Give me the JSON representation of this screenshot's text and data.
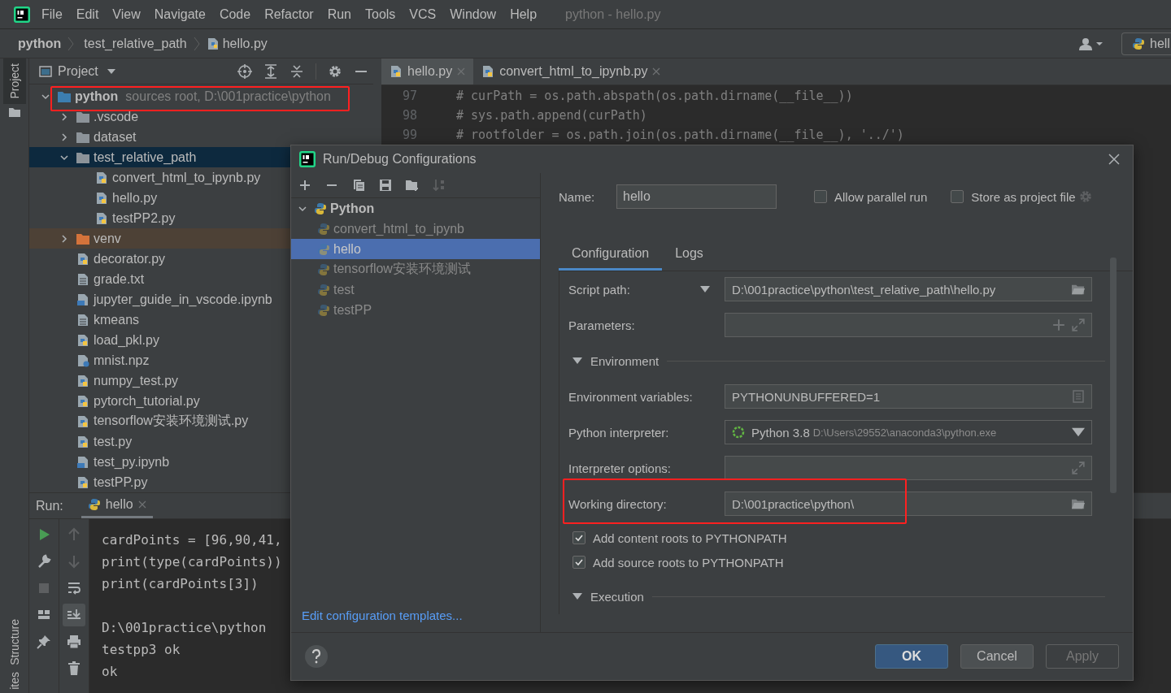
{
  "menu_bar": {
    "items": [
      "File",
      "Edit",
      "View",
      "Navigate",
      "Code",
      "Refactor",
      "Run",
      "Tools",
      "VCS",
      "Window",
      "Help"
    ],
    "title": "python - hello.py"
  },
  "breadcrumbs": [
    "python",
    "test_relative_path",
    "hello.py"
  ],
  "run_config": "hell",
  "side_tabs": {
    "top": [
      {
        "label": "Project",
        "selected": true
      }
    ],
    "bottom": [
      {
        "label": "Structure",
        "selected": false
      },
      {
        "label": "ites",
        "selected": false
      }
    ]
  },
  "project_panel": {
    "title": "Project",
    "tree": [
      {
        "name": "python",
        "kind": "root",
        "note": "sources root,  D:\\001practice\\python",
        "expanded": true,
        "selected": false,
        "children": [
          {
            "name": ".vscode",
            "kind": "folder",
            "expanded": false,
            "selected": false
          },
          {
            "name": "dataset",
            "kind": "folder",
            "expanded": false,
            "selected": false
          },
          {
            "name": "test_relative_path",
            "kind": "folder",
            "expanded": true,
            "selected": true,
            "children": [
              {
                "name": "convert_html_to_ipynb.py",
                "kind": "python",
                "selected": false
              },
              {
                "name": "hello.py",
                "kind": "python",
                "selected": false
              },
              {
                "name": "testPP2.py",
                "kind": "python",
                "selected": false
              }
            ]
          },
          {
            "name": "venv",
            "kind": "excluded",
            "expanded": false,
            "selected": false
          },
          {
            "name": "decorator.py",
            "kind": "python",
            "selected": false
          },
          {
            "name": "grade.txt",
            "kind": "text",
            "selected": false
          },
          {
            "name": "jupyter_guide_in_vscode.ipynb",
            "kind": "notebook",
            "selected": false
          },
          {
            "name": "kmeans",
            "kind": "text",
            "selected": false
          },
          {
            "name": "load_pkl.py",
            "kind": "python",
            "selected": false
          },
          {
            "name": "mnist.npz",
            "kind": "unknown",
            "selected": false
          },
          {
            "name": "numpy_test.py",
            "kind": "python",
            "selected": false
          },
          {
            "name": "pytorch_tutorial.py",
            "kind": "python",
            "selected": false
          },
          {
            "name": "tensorflow安装环境测试.py",
            "kind": "python",
            "selected": false
          },
          {
            "name": "test.py",
            "kind": "python",
            "selected": false
          },
          {
            "name": "test_py.ipynb",
            "kind": "notebook",
            "selected": false
          },
          {
            "name": "testPP.py",
            "kind": "python",
            "selected": false
          }
        ]
      }
    ]
  },
  "editor": {
    "tabs": [
      {
        "label": "hello.py",
        "selected": true
      },
      {
        "label": "convert_html_to_ipynb.py",
        "selected": false
      }
    ],
    "lines": [
      {
        "number": "97",
        "code": "# curPath = os.path.abspath(os.path.dirname(__file__))"
      },
      {
        "number": "98",
        "code": "# sys.path.append(curPath)"
      },
      {
        "number": "99",
        "code": "# rootfolder = os.path.join(os.path.dirname(__file__), '../')"
      }
    ]
  },
  "run_panel": {
    "label": "Run:",
    "tab": "hello",
    "console": [
      [
        "cardPoints = [96,90,41,",
        "print(type(cardPoints))",
        "print(cardPoints[3])"
      ],
      [
        "D:\\001practice\\python",
        "testpp3 ok",
        "ok"
      ]
    ]
  },
  "dialog": {
    "title": "Run/Debug Configurations",
    "tree": [
      {
        "name": "Python",
        "expanded": true,
        "children": [
          {
            "name": "convert_html_to_ipynb",
            "selected": false,
            "temporary": true
          },
          {
            "name": "hello",
            "selected": true,
            "temporary": true
          },
          {
            "name": "tensorflow安装环境测试",
            "selected": false,
            "temporary": true
          },
          {
            "name": "test",
            "selected": false,
            "temporary": true
          },
          {
            "name": "testPP",
            "selected": false,
            "temporary": true
          }
        ]
      }
    ],
    "templates_link": "Edit configuration templates...",
    "name_label": "Name:",
    "name_value": "hello",
    "options": [
      {
        "label": "Allow parallel run",
        "checked": false
      },
      {
        "label": "Store as project file",
        "checked": false
      }
    ],
    "tabs": [
      {
        "label": "Configuration",
        "selected": true
      },
      {
        "label": "Logs",
        "selected": false
      }
    ],
    "rows": [
      {
        "kind": "script-path",
        "label": "Script path:",
        "value": "D:\\001practice\\python\\test_relative_path\\hello.py"
      },
      {
        "kind": "params",
        "label": "Parameters:"
      },
      {
        "kind": "section",
        "label": "Environment",
        "expanded": true
      },
      {
        "kind": "env",
        "label": "Environment variables:",
        "value": "PYTHONUNBUFFERED=1"
      },
      {
        "kind": "interpreter",
        "label": "Python interpreter:",
        "value": "Python 3.8",
        "detail": "D:\\Users\\29552\\anaconda3\\python.exe"
      },
      {
        "kind": "options",
        "label": "Interpreter options:"
      },
      {
        "kind": "path",
        "label": "Working directory:",
        "value": "D:\\001practice\\python\\"
      },
      {
        "kind": "checkbox",
        "label": "Add content roots to PYTHONPATH",
        "checked": true
      },
      {
        "kind": "checkbox",
        "label": "Add source roots to PYTHONPATH",
        "checked": true
      },
      {
        "kind": "section",
        "label": "Execution",
        "expanded": true
      }
    ],
    "buttons": [
      {
        "label": "OK",
        "kind": "primary"
      },
      {
        "label": "Cancel",
        "kind": "normal"
      },
      {
        "label": "Apply",
        "kind": "disabled"
      }
    ]
  }
}
